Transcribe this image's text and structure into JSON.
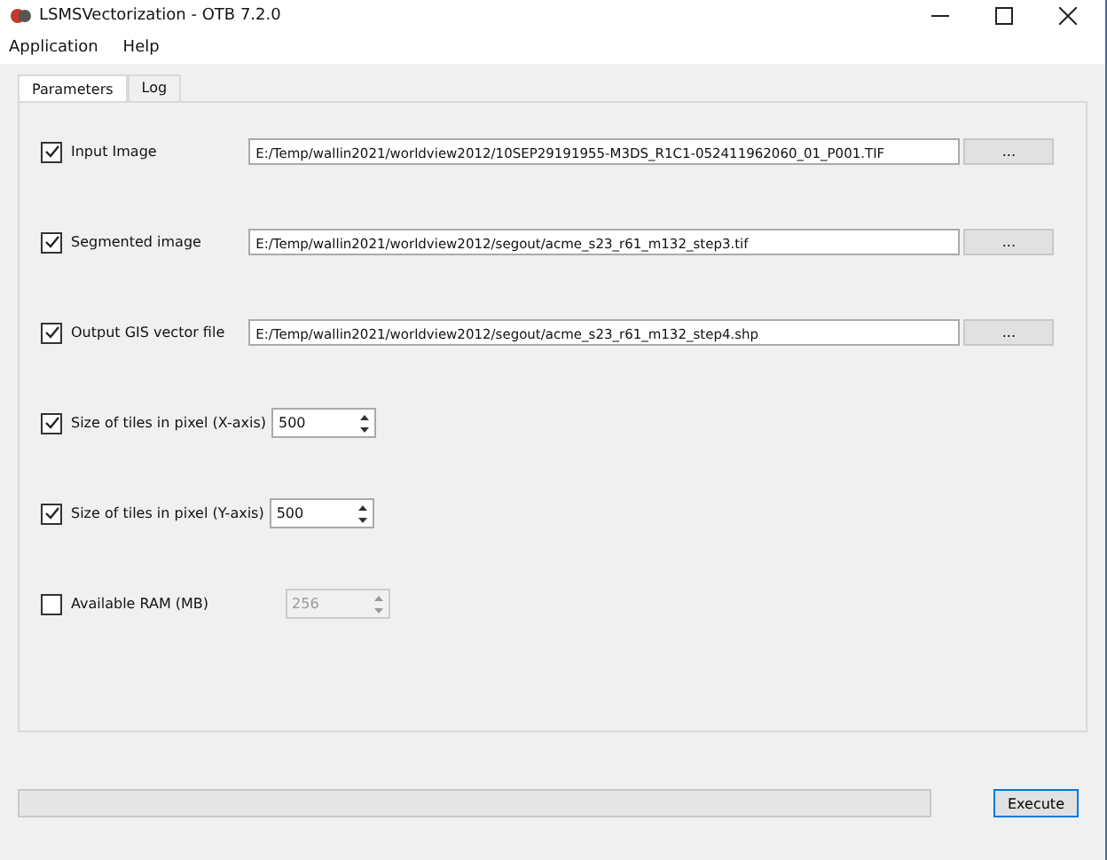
{
  "window": {
    "title": "LSMSVectorization - OTB 7.2.0"
  },
  "menu": [
    "Application",
    "Help"
  ],
  "tabs": [
    {
      "label": "Parameters",
      "selected": true
    },
    {
      "label": "Log",
      "selected": false
    }
  ],
  "parameters": [
    {
      "kind": "file",
      "label": "Input Image",
      "checked": true,
      "value": "E:/Temp/wallin2021/worldview2012/10SEP29191955-M3DS_R1C1-052411962060_01_P001.TIF",
      "button": "..."
    },
    {
      "kind": "file",
      "label": "Segmented image",
      "checked": true,
      "value": "E:/Temp/wallin2021/worldview2012/segout/acme_s23_r61_m132_step3.tif",
      "button": "..."
    },
    {
      "kind": "file",
      "label": "Output GIS vector file",
      "checked": true,
      "value": "E:/Temp/wallin2021/worldview2012/segout/acme_s23_r61_m132_step4.shp",
      "button": "..."
    },
    {
      "kind": "spin",
      "label": "Size of tiles in pixel (X-axis)",
      "checked": true,
      "value": "500",
      "disabled": false
    },
    {
      "kind": "spin",
      "label": "Size of tiles in pixel (Y-axis)",
      "checked": true,
      "value": "500",
      "disabled": false
    },
    {
      "kind": "spin",
      "label": "Available RAM (MB)",
      "checked": false,
      "value": "256",
      "disabled": true
    }
  ],
  "progress": {
    "level": 0
  },
  "execute_button": "Execute"
}
